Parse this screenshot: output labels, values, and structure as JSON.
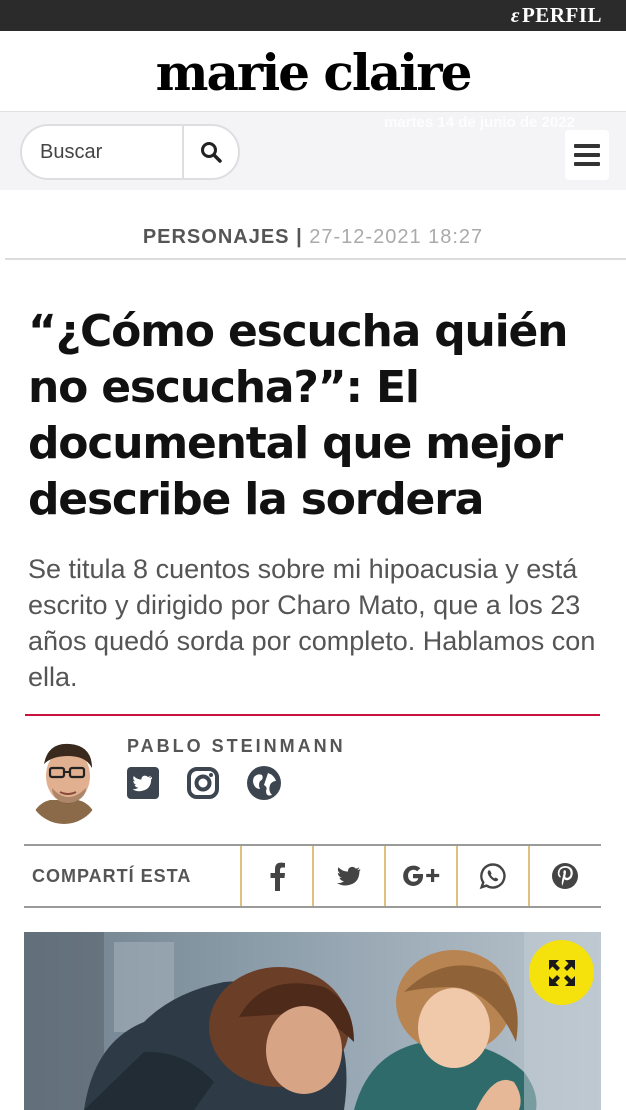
{
  "header": {
    "network_logo": "PERFIL",
    "site_logo": "marie claire",
    "date_watermark": "martes 14 de junio de 2022"
  },
  "search": {
    "placeholder": "Buscar",
    "search_icon": "search-icon",
    "menu_icon": "hamburger-menu-icon"
  },
  "article": {
    "section": "PERSONAJES",
    "separator": "|",
    "datetime": "27-12-2021 18:27",
    "headline": "“¿Cómo escucha quién no escucha?”: El documental que mejor describe la sordera",
    "dek": "Se titula 8 cuentos sobre mi hipoacusia y está escrito y dirigido por Charo Mato, que a los 23 años quedó sorda por completo. Hablamos con ella.",
    "accent_color": "#c8143c"
  },
  "author": {
    "name": "PABLO STEINMANN",
    "links": [
      "twitter-icon",
      "instagram-icon",
      "globe-icon"
    ]
  },
  "share": {
    "label": "COMPARTÍ ESTA",
    "networks": [
      "facebook-icon",
      "twitter-icon",
      "google-plus-icon",
      "whatsapp-icon",
      "pinterest-icon"
    ]
  },
  "media": {
    "expand_icon": "expand-icon",
    "expand_color": "#f5e10c"
  }
}
